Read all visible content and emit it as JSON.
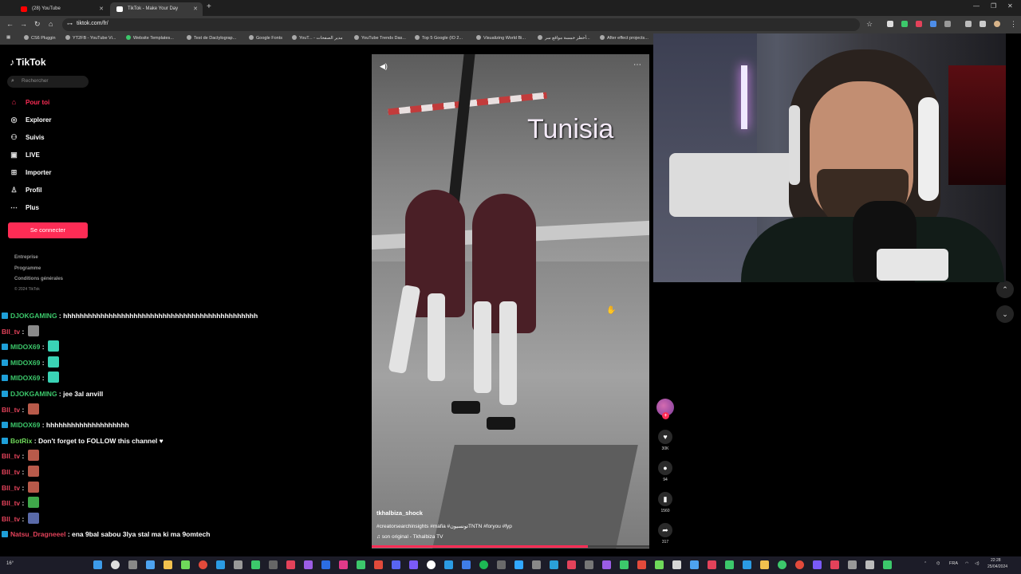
{
  "browser": {
    "tabs": [
      {
        "label": "(28) YouTube",
        "color": "#ff0000"
      },
      {
        "label": "TikTok - Make Your Day",
        "color": "#ffffff"
      }
    ],
    "url": "tiktok.com/fr/",
    "bookmarks": [
      "CS6 Pluggin",
      "YT2FB - YouTube Vi...",
      "Website Templates...",
      "Test de Dactylograp...",
      "Google Fonts",
      "YouT... - مدير الصفحات",
      "YouTube Trends Das...",
      "Top 5 Google (IO 2...",
      "Visualizing World Bi...",
      "أخطر خمسة مواقع سر...",
      "After effect projects..."
    ]
  },
  "tiktok": {
    "logo": "TikTok",
    "search_placeholder": "Rechercher",
    "menu": [
      {
        "label": "Pour toi",
        "icon": "home-icon",
        "glyph": "⌂",
        "active": true
      },
      {
        "label": "Explorer",
        "icon": "compass-icon",
        "glyph": "◎",
        "active": false
      },
      {
        "label": "Suivis",
        "icon": "following-icon",
        "glyph": "⚇",
        "active": false
      },
      {
        "label": "LIVE",
        "icon": "live-icon",
        "glyph": "▣",
        "active": false
      },
      {
        "label": "Importer",
        "icon": "upload-icon",
        "glyph": "⊞",
        "active": false
      },
      {
        "label": "Profil",
        "icon": "profile-icon",
        "glyph": "♙",
        "active": false
      },
      {
        "label": "Plus",
        "icon": "more-icon",
        "glyph": "⋯",
        "active": false
      }
    ],
    "connect_button": "Se connecter",
    "footer_links": [
      "Entreprise",
      "Programme",
      "Conditions générales"
    ],
    "copyright": "© 2024 TikTok",
    "accent": "#fe2c55"
  },
  "chat": [
    {
      "user": "DJOKGAMING",
      "color": "#3cc86b",
      "msg": "hhhhhhhhhhhhhhhhhhhhhhhhhhhhhhhhhhhhhhhhhhhhhhh",
      "badge": true
    },
    {
      "user": "Bll_tv",
      "color": "#e3425a",
      "msg": "",
      "emote": "#8a8a8a"
    },
    {
      "user": "MIDOX69",
      "color": "#3cc86b",
      "msg": "",
      "emote": "#3ad3b5",
      "badge": true
    },
    {
      "user": "MIDOX69",
      "color": "#3cc86b",
      "msg": "",
      "emote": "#3ad3b5",
      "badge": true
    },
    {
      "user": "MIDOX69",
      "color": "#3cc86b",
      "msg": "",
      "emote": "#3ad3b5",
      "badge": true
    },
    {
      "user": "DJOKGAMING",
      "color": "#3cc86b",
      "msg": "jee 3al anvill",
      "badge": true
    },
    {
      "user": "Bll_tv",
      "color": "#e3425a",
      "msg": "",
      "emote": "#b85a4a"
    },
    {
      "user": "MIDOX69",
      "color": "#3cc86b",
      "msg": "hhhhhhhhhhhhhhhhhhhh",
      "badge": true
    },
    {
      "user": "BotRix",
      "color": "#6fd95a",
      "msg": "Don't forget to FOLLOW this channel ♥",
      "badge": true
    },
    {
      "user": "Bll_tv",
      "color": "#e3425a",
      "msg": "",
      "emote": "#b85a4a"
    },
    {
      "user": "Bll_tv",
      "color": "#e3425a",
      "msg": "",
      "emote": "#b85a4a"
    },
    {
      "user": "Bll_tv",
      "color": "#e3425a",
      "msg": "",
      "emote": "#b85a4a"
    },
    {
      "user": "Bll_tv",
      "color": "#e3425a",
      "msg": "",
      "emote": "#3fa84a"
    },
    {
      "user": "Bll_tv",
      "color": "#e3425a",
      "msg": "",
      "emote": "#5a6aa8"
    },
    {
      "user": "Natsu_Dragneeel",
      "color": "#e3425a",
      "msg": "ena 9bal sabou 3lya stal ma ki ma 9omtech",
      "badge": true
    }
  ],
  "video": {
    "caption": "Tunisia",
    "username": "tkhalbiza_shock",
    "hashtags": "#creatorsearchinsights #mafia #تونسيونTNTN #foryou #fyp",
    "sound": "son original - Tkhalbiza TV",
    "progress": 0.78,
    "likes": "30K",
    "comments": "94",
    "saves": "1560",
    "shares": "317"
  },
  "taskbar": {
    "weather": "16°",
    "language": "FRA",
    "time": "22:28",
    "date": "25/04/2024"
  }
}
